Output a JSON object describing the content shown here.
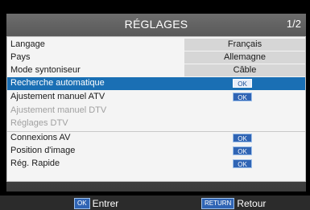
{
  "header": {
    "title": "RÉGLAGES",
    "page": "1/2"
  },
  "rows": [
    {
      "label": "Langage",
      "value": "Français"
    },
    {
      "label": "Pays",
      "value": "Allemagne"
    },
    {
      "label": "Mode syntoniseur",
      "value": "Câble"
    },
    {
      "label": "Recherche automatique",
      "button": "OK"
    },
    {
      "label": "Ajustement manuel ATV",
      "button": "OK"
    },
    {
      "label": "Ajustement manuel DTV"
    },
    {
      "label": "Réglages DTV"
    },
    {
      "label": "Connexions AV",
      "button": "OK"
    },
    {
      "label": "Position d'image",
      "button": "OK"
    },
    {
      "label": "Rég. Rapide",
      "button": "OK"
    }
  ],
  "footer": {
    "enter_key": "OK",
    "enter_label": "Entrer",
    "return_key": "RETURN",
    "return_label": "Retour"
  },
  "colors": {
    "selection": "#1a6fb4",
    "button": "#2f64b4"
  }
}
